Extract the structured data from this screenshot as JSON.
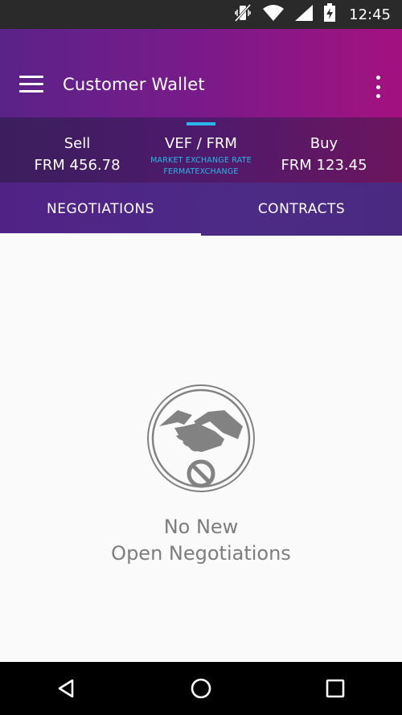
{
  "status_bar": {
    "time": "12:45",
    "icons": [
      "vibrate-off-icon",
      "wifi-icon",
      "cell-signal-icon",
      "battery-charging-icon"
    ]
  },
  "app_bar": {
    "title": "Customer Wallet",
    "menu_icon": "hamburger-menu-icon",
    "overflow_icon": "more-vert-icon"
  },
  "exchange": {
    "sell_label": "Sell",
    "sell_value": "FRM 456.78",
    "pair": "VEF / FRM",
    "rate_type": "MARKET EXCHANGE RATE",
    "provider": "FERMATEXCHANGE",
    "buy_label": "Buy",
    "buy_value": "FRM 123.45"
  },
  "tabs": [
    {
      "label": "NEGOTIATIONS",
      "selected": true
    },
    {
      "label": "CONTRACTS",
      "selected": false
    }
  ],
  "empty_state": {
    "icon": "handshake-forbidden-icon",
    "line1": "No New",
    "line2": "Open Negotiations"
  },
  "nav_bar": {
    "icons": [
      "back-icon",
      "home-icon",
      "recents-icon"
    ]
  },
  "colors": {
    "accent": "#29b6e8",
    "app_bar_start": "#5a2388",
    "app_bar_end": "#a3127f",
    "empty_text": "#7d7d7d",
    "icon_gray": "#828282"
  }
}
